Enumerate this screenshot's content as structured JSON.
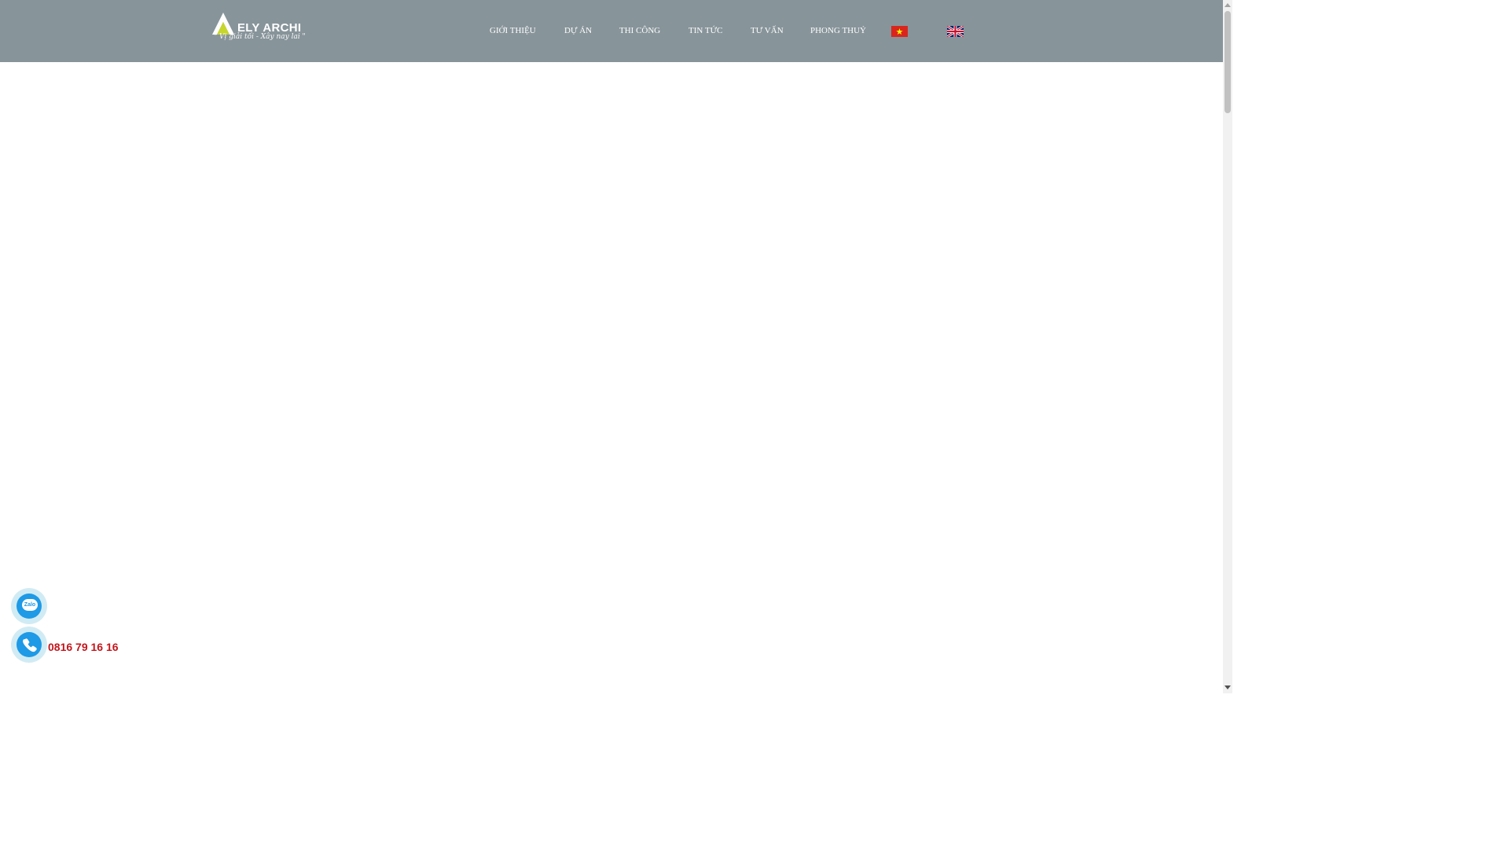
{
  "header": {
    "logo": {
      "name": "ELY ARCHI",
      "tagline": "\" Vị giải tối - Xây nay lai \""
    },
    "nav": [
      {
        "label": "GIỚI THIỆU"
      },
      {
        "label": "DỰ ÁN"
      },
      {
        "label": "THI CÔNG"
      },
      {
        "label": "TIN TỨC"
      },
      {
        "label": "TƯ VẤN"
      },
      {
        "label": "PHONG THUỶ"
      }
    ],
    "languages": [
      {
        "icon": "vietnam-flag-icon"
      },
      {
        "icon": "uk-flag-icon"
      }
    ]
  },
  "contact": {
    "zalo_icon": "zalo-icon",
    "zalo_label": "Zalo",
    "phone_icon": "phone-icon",
    "phone_number": "0816 79 16 16"
  },
  "colors": {
    "header_bg": "#87949a",
    "accent": "#1e9ae6",
    "phone_text": "#c4161c"
  }
}
